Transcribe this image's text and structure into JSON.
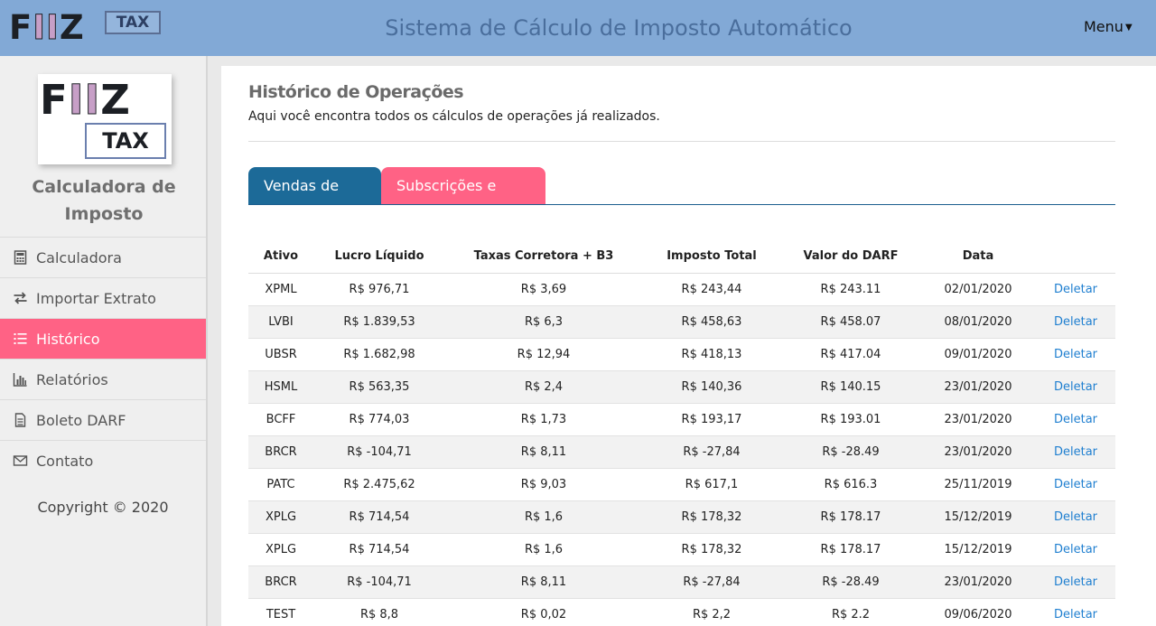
{
  "header": {
    "logo_fiiz": "FIIZ",
    "logo_tax": "TAX",
    "title": "Sistema de Cálculo de Imposto Automático",
    "menu_label": "Menu"
  },
  "sidebar": {
    "logo_fiiz": "FIIZ",
    "logo_tax": "TAX",
    "brand_line1": "Calculadora de",
    "brand_line2": "Imposto",
    "items": [
      {
        "label": "Calculadora",
        "icon": "calculator-icon"
      },
      {
        "label": "Importar Extrato",
        "icon": "exchange-icon"
      },
      {
        "label": "Histórico",
        "icon": "list-icon",
        "active": true
      },
      {
        "label": "Relatórios",
        "icon": "bar-chart-icon"
      },
      {
        "label": "Boleto DARF",
        "icon": "document-icon"
      },
      {
        "label": "Contato",
        "icon": "envelope-icon"
      }
    ],
    "copyright": "Copyright © 2020"
  },
  "main": {
    "title": "Histórico de Operações",
    "subtitle": "Aqui você encontra todos os cálculos de operações já realizados.",
    "tabs": [
      {
        "label": "Vendas de FIIs",
        "active": true
      },
      {
        "label": "Subscrições e IPOs",
        "active": false
      }
    ],
    "table": {
      "headers": [
        "Ativo",
        "Lucro Líquido",
        "Taxas Corretora + B3",
        "Imposto Total",
        "Valor do DARF",
        "Data",
        ""
      ],
      "delete_label": "Deletar",
      "rows": [
        [
          "XPML",
          "R$ 976,71",
          "R$ 3,69",
          "R$ 243,44",
          "R$ 243.11",
          "02/01/2020"
        ],
        [
          "LVBI",
          "R$ 1.839,53",
          "R$ 6,3",
          "R$ 458,63",
          "R$ 458.07",
          "08/01/2020"
        ],
        [
          "UBSR",
          "R$ 1.682,98",
          "R$ 12,94",
          "R$ 418,13",
          "R$ 417.04",
          "09/01/2020"
        ],
        [
          "HSML",
          "R$ 563,35",
          "R$ 2,4",
          "R$ 140,36",
          "R$ 140.15",
          "23/01/2020"
        ],
        [
          "BCFF",
          "R$ 774,03",
          "R$ 1,73",
          "R$ 193,17",
          "R$ 193.01",
          "23/01/2020"
        ],
        [
          "BRCR",
          "R$ -104,71",
          "R$ 8,11",
          "R$ -27,84",
          "R$ -28.49",
          "23/01/2020"
        ],
        [
          "PATC",
          "R$ 2.475,62",
          "R$ 9,03",
          "R$ 617,1",
          "R$ 616.3",
          "25/11/2019"
        ],
        [
          "XPLG",
          "R$ 714,54",
          "R$ 1,6",
          "R$ 178,32",
          "R$ 178.17",
          "15/12/2019"
        ],
        [
          "XPLG",
          "R$ 714,54",
          "R$ 1,6",
          "R$ 178,32",
          "R$ 178.17",
          "15/12/2019"
        ],
        [
          "BRCR",
          "R$ -104,71",
          "R$ 8,11",
          "R$ -27,84",
          "R$ -28.49",
          "23/01/2020"
        ],
        [
          "TEST",
          "R$ 8,8",
          "R$ 0,02",
          "R$ 2,2",
          "R$ 2.2",
          "09/06/2020"
        ]
      ]
    }
  },
  "colors": {
    "header_bg": "#82a9d6",
    "accent_pink": "#ff6285",
    "tab_blue": "#1c6a98",
    "link_blue": "#1f7fd0"
  }
}
